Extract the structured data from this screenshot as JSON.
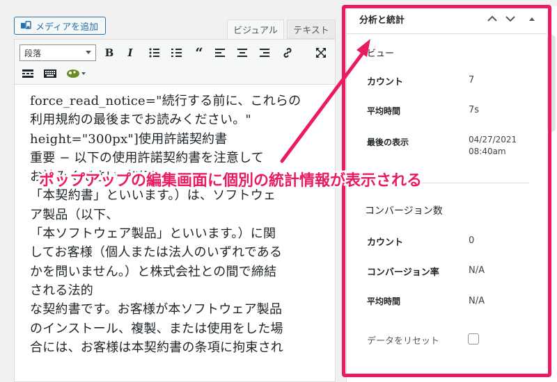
{
  "editor": {
    "media_button_label": "メディアを追加",
    "tabs": {
      "visual": "ビジュアル",
      "text": "テキスト"
    },
    "format_select": "段落",
    "toolbar_icons": [
      "bold-icon",
      "italic-icon",
      "bullet-list-icon",
      "numbered-list-icon",
      "blockquote-icon",
      "align-left-icon",
      "align-center-icon",
      "align-right-icon",
      "link-icon",
      "fullscreen-icon",
      "more-tag-icon",
      "keyboard-icon",
      "plugin-icon"
    ],
    "content_text": "force_read_notice=\"続行する前に、これらの\n利用規約の最後までお読みください。\"\nheight=\"300px\"]使用許諾契約書\n重要 − 以下の使用許諾契約書を注意して\nお読みください（以下、\n「本契約書」といいます。）は、ソフトウェ\nア製品（以下、\n「本ソフトウェア製品」といいます。）に関\nしてお客様（個人または法人のいずれである\nかを問いません。）と株式会社との間で締結\nされる法的\nな契約書です。お客様が本ソフトウェア製品\nのインストール、複製、または使用をした場\n合には、お客様は本契約書の条項に拘束され"
  },
  "sidebar": {
    "title": "分析と統計",
    "sections": {
      "views": {
        "heading": "ビュー",
        "rows": [
          {
            "label": "カウント",
            "value": "7"
          },
          {
            "label": "平均時間",
            "value": "7s"
          },
          {
            "label": "最後の表示",
            "value": "04/27/2021\n08:40am"
          }
        ]
      },
      "conversions": {
        "heading": "コンバージョン数",
        "rows": [
          {
            "label": "カウント",
            "value": "0"
          },
          {
            "label": "コンバージョン率",
            "value": "N/A"
          },
          {
            "label": "平均時間",
            "value": "N/A"
          }
        ]
      }
    },
    "reset_label": "データをリセット",
    "reset_checked": false
  },
  "annotation": {
    "text": "ポップアップの編集画面に個別の統計情報が表示される",
    "color": "#ea1a63"
  },
  "colors": {
    "accent": "#2271b1",
    "highlight": "#ea1a63"
  }
}
